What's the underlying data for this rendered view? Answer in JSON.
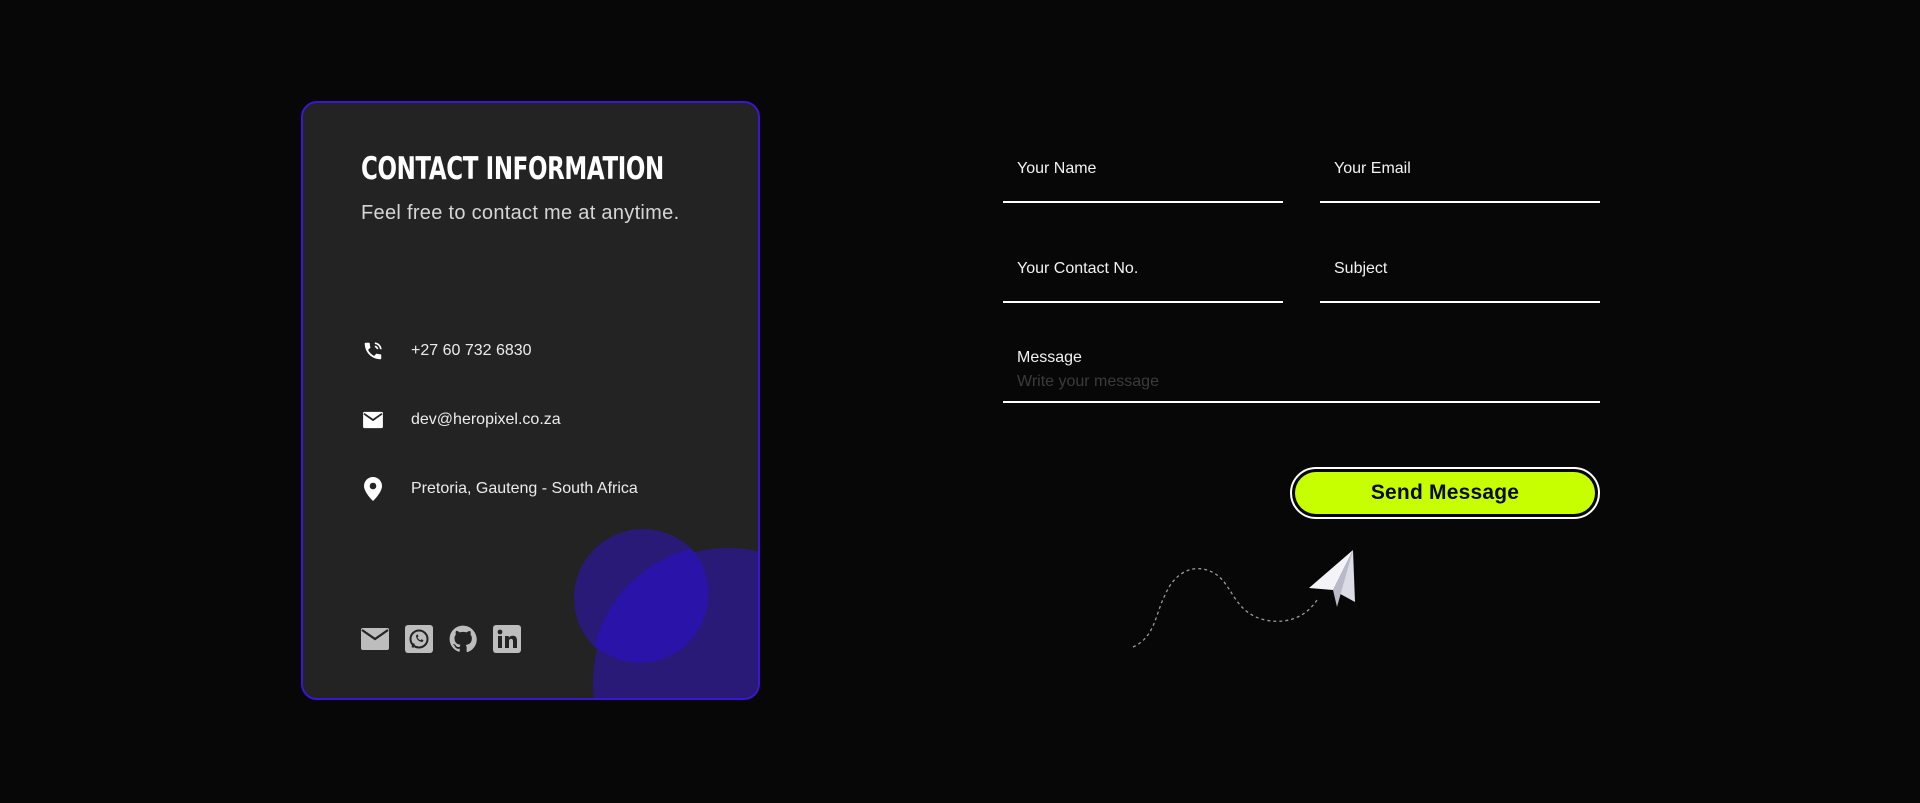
{
  "contact_card": {
    "title": "CONTACT INFORMATION",
    "subtitle": "Feel free to contact me at anytime.",
    "phone": "+27 60 732 6830",
    "email": "dev@heropixel.co.za",
    "location": "Pretoria, Gauteng - South Africa",
    "icons": {
      "phone": "phone-icon",
      "email": "mail-icon",
      "location": "location-pin-icon"
    },
    "socials": [
      "mail-icon",
      "whatsapp-icon",
      "github-icon",
      "linkedin-icon"
    ]
  },
  "form": {
    "name_label": "Your Name",
    "email_label": "Your Email",
    "contact_label": "Your Contact No.",
    "subject_label": "Subject",
    "message_label": "Message",
    "message_placeholder": "Write your message",
    "send_label": "Send Message"
  },
  "colors": {
    "background": "#070707",
    "card": "#232323",
    "card_border": "#3b14d6",
    "accent_blob": "#2a1a78",
    "button": "#c8ff00"
  }
}
